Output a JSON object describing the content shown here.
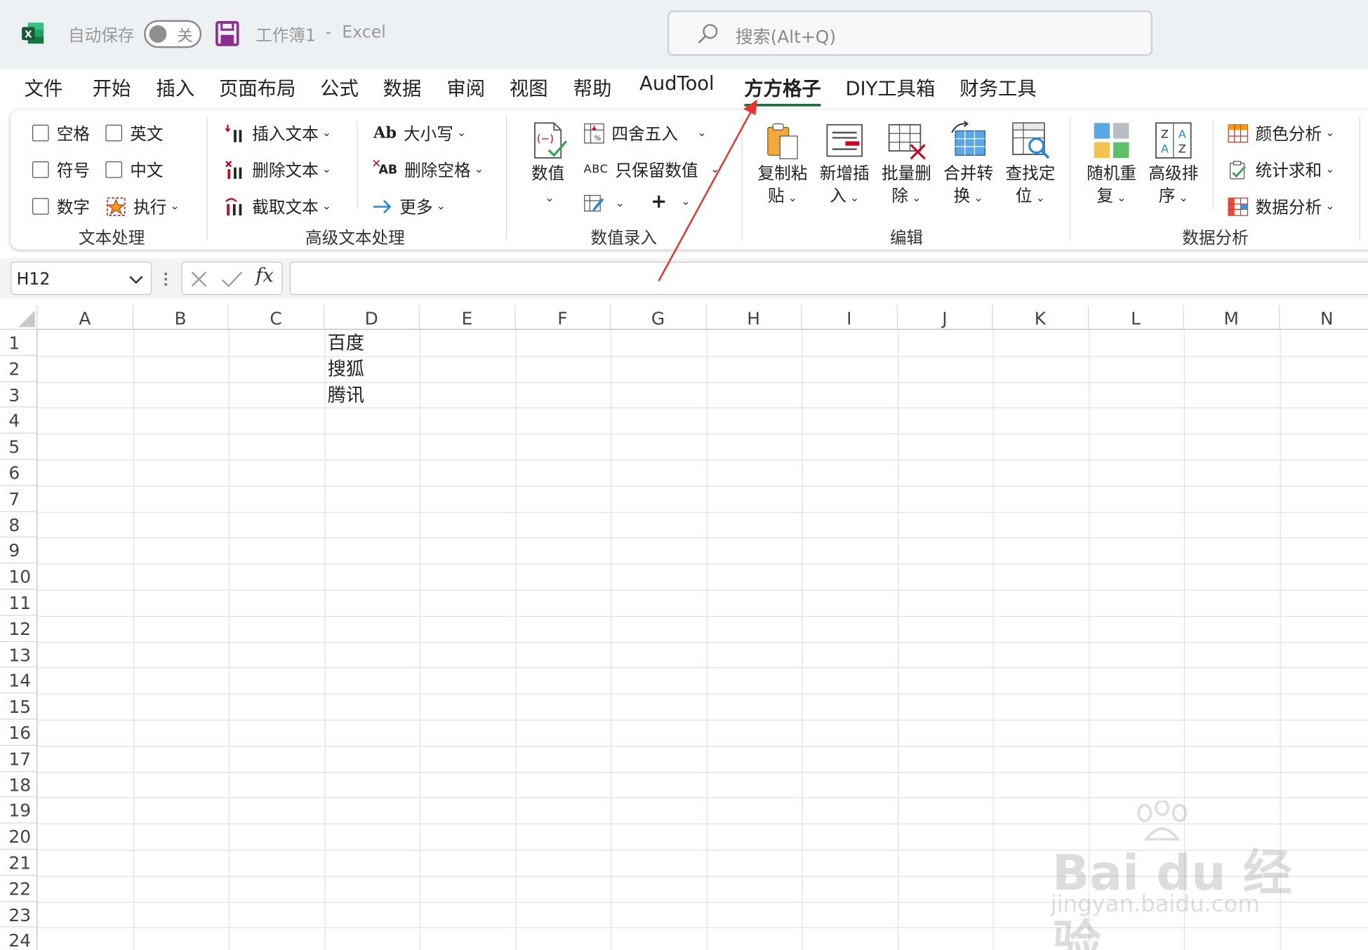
{
  "titlebar": {
    "autosave_label": "自动保存",
    "autosave_state": "关",
    "document_title": "工作簿1",
    "separator": "-",
    "app_name": "Excel",
    "search_placeholder": "搜索(Alt+Q)"
  },
  "tabs": [
    {
      "label": "文件"
    },
    {
      "label": "开始"
    },
    {
      "label": "插入"
    },
    {
      "label": "页面布局"
    },
    {
      "label": "公式"
    },
    {
      "label": "数据"
    },
    {
      "label": "审阅"
    },
    {
      "label": "视图"
    },
    {
      "label": "帮助"
    },
    {
      "label": "AudTool"
    },
    {
      "label": "方方格子",
      "active": true
    },
    {
      "label": "DIY工具箱"
    },
    {
      "label": "财务工具"
    }
  ],
  "ribbon": {
    "text_processing": {
      "label": "文本处理",
      "checkboxes": [
        "空格",
        "英文",
        "符号",
        "中文",
        "数字"
      ],
      "execute": "执行"
    },
    "advanced_text": {
      "label": "高级文本处理",
      "insert_text": "插入文本",
      "delete_text": "删除文本",
      "extract_text": "截取文本",
      "case": "大小写",
      "case_icon_text": "Ab",
      "delete_space": "删除空格",
      "delete_space_icon_text": "AB",
      "more": "更多"
    },
    "value_entry": {
      "label": "数值录入",
      "value": "数值",
      "round": "四舍五入",
      "keep_numbers": "只保留数值",
      "keep_numbers_icon_text": "ABC"
    },
    "edit": {
      "label": "编辑",
      "copy_paste": [
        "复制粘",
        "贴"
      ],
      "new_insert": [
        "新增插",
        "入"
      ],
      "batch_delete": [
        "批量删",
        "除"
      ],
      "merge_convert": [
        "合并转",
        "换"
      ],
      "find_locate": [
        "查找定",
        "位"
      ]
    },
    "data_analysis": {
      "label": "数据分析",
      "random_repeat": [
        "随机重",
        "复"
      ],
      "advanced_sort": [
        "高级排",
        "序"
      ],
      "color_analysis": "颜色分析",
      "stat_sum": "统计求和",
      "data_analysis_btn": "数据分析"
    }
  },
  "formula_bar": {
    "name_box": "H12",
    "fx_label": "fx",
    "formula": ""
  },
  "sheet": {
    "columns": [
      "A",
      "B",
      "C",
      "D",
      "E",
      "F",
      "G",
      "H",
      "I",
      "J",
      "K",
      "L",
      "M",
      "N"
    ],
    "rows": [
      "1",
      "2",
      "3",
      "4",
      "5",
      "6",
      "7",
      "8",
      "9",
      "10",
      "11",
      "12",
      "13",
      "14",
      "15",
      "16",
      "17",
      "18",
      "19",
      "20",
      "21",
      "22",
      "23",
      "24"
    ],
    "cells": {
      "D1": "百度",
      "D2": "搜狐",
      "D3": "腾讯"
    }
  },
  "watermark": {
    "line1": "Bai du 经验",
    "line2": "jingyan.baidu.com"
  },
  "colors": {
    "excel_green": "#1d6f42",
    "active_tab_underline": "#1b6b3b",
    "annotation_arrow": "#e8332f"
  }
}
